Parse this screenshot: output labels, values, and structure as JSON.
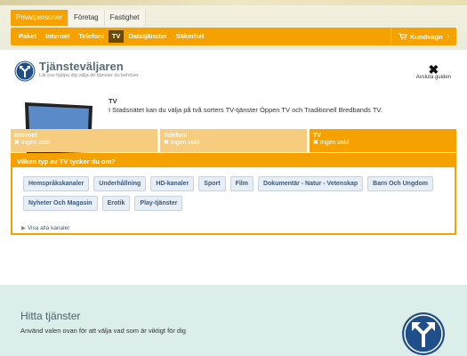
{
  "segments": [
    "Privatpersoner",
    "Företag",
    "Fastighet"
  ],
  "menu": [
    "Paket",
    "Internet",
    "Telefoni",
    "TV",
    "Datatjänster",
    "Säkerhet"
  ],
  "cart_label": "Kundvagn",
  "wizard": {
    "title": "Tjänsteväljaren",
    "subtitle": "Låt oss hjälpa dig välja de tjänster du behöver",
    "close_label": "Avsluta guiden"
  },
  "tv": {
    "title": "TV",
    "description": "I Stadsnätet kan du välja på två sorters TV-tjänster Öppen TV och Traditionell Bredbands TV."
  },
  "categories": [
    {
      "name": "Internet",
      "status": "Ingen vald"
    },
    {
      "name": "Telefoni",
      "status": "Ingen vald"
    },
    {
      "name": "TV",
      "status": "Ingen vald"
    }
  ],
  "question": "Vilken typ av TV tycker du om?",
  "options": [
    "Hemspråkskanaler",
    "Underhållning",
    "HD-kanaler",
    "Sport",
    "Film",
    "Dokumentär - Natur - Vetenskap",
    "Barn Och Ungdom",
    "Nyheter Och Magasin",
    "Erotik",
    "Play-tjänster"
  ],
  "show_all": "Visa alla kanaler",
  "bottom": {
    "title": "Hitta tjänster",
    "subtitle": "Använd valen ovan för att välja vad som är viktigt för dig"
  },
  "colors": {
    "accent": "#f5a200",
    "accent_light": "#f6cc7e",
    "logo": "#1f4f8a"
  }
}
